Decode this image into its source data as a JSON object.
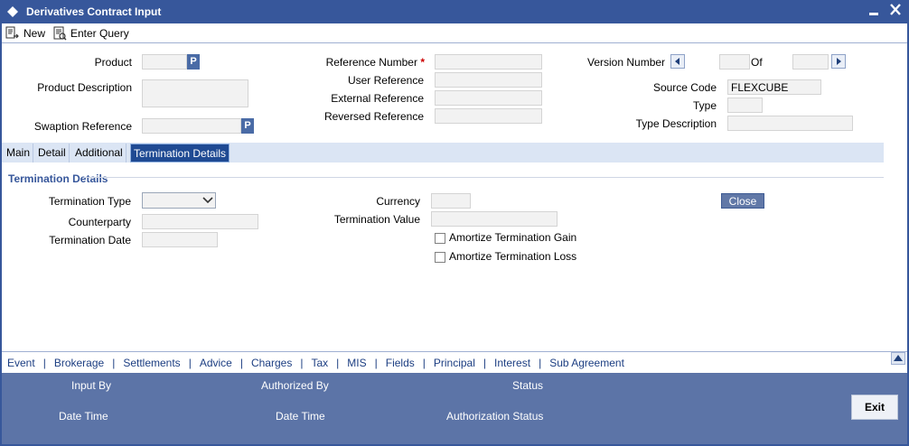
{
  "window": {
    "title": "Derivatives Contract Input"
  },
  "toolbar": {
    "new_label": "New",
    "enter_query_label": "Enter Query"
  },
  "header": {
    "product_label": "Product",
    "product_value": "",
    "product_desc_label": "Product Description",
    "swaption_ref_label": "Swaption Reference",
    "pick_button": "P",
    "reference_number_label": "Reference Number",
    "required_mark": "*",
    "user_reference_label": "User Reference",
    "external_reference_label": "External Reference",
    "reversed_reference_label": "Reversed Reference",
    "version_number_label": "Version Number",
    "of_label": "Of",
    "source_code_label": "Source Code",
    "source_code_value": "FLEXCUBE",
    "type_label": "Type",
    "type_description_label": "Type Description"
  },
  "tabs": [
    {
      "label": "Main"
    },
    {
      "label": "Detail"
    },
    {
      "label": "Additional"
    },
    {
      "label": "Termination Details"
    }
  ],
  "termination": {
    "section_title": "Termination Details",
    "termination_type_label": "Termination Type",
    "termination_type_value": "",
    "counterparty_label": "Counterparty",
    "termination_date_label": "Termination Date",
    "currency_label": "Currency",
    "termination_value_label": "Termination Value",
    "amortize_gain_label": "Amortize Termination Gain",
    "amortize_loss_label": "Amortize Termination Loss",
    "close_label": "Close"
  },
  "bottom_nav": {
    "links": [
      "Event",
      "Brokerage",
      "Settlements",
      "Advice",
      "Charges",
      "Tax",
      "MIS",
      "Fields",
      "Principal",
      "Interest",
      "Sub Agreement"
    ]
  },
  "footer": {
    "input_by_label": "Input By",
    "date_time_label": "Date Time",
    "authorized_by_label": "Authorized By",
    "date_time2_label": "Date Time",
    "status_label": "Status",
    "authorization_status_label": "Authorization Status",
    "exit_label": "Exit"
  },
  "colors": {
    "titlebar": "#37579b",
    "active_tab": "#1f4a93",
    "footer": "#5c74a7"
  }
}
